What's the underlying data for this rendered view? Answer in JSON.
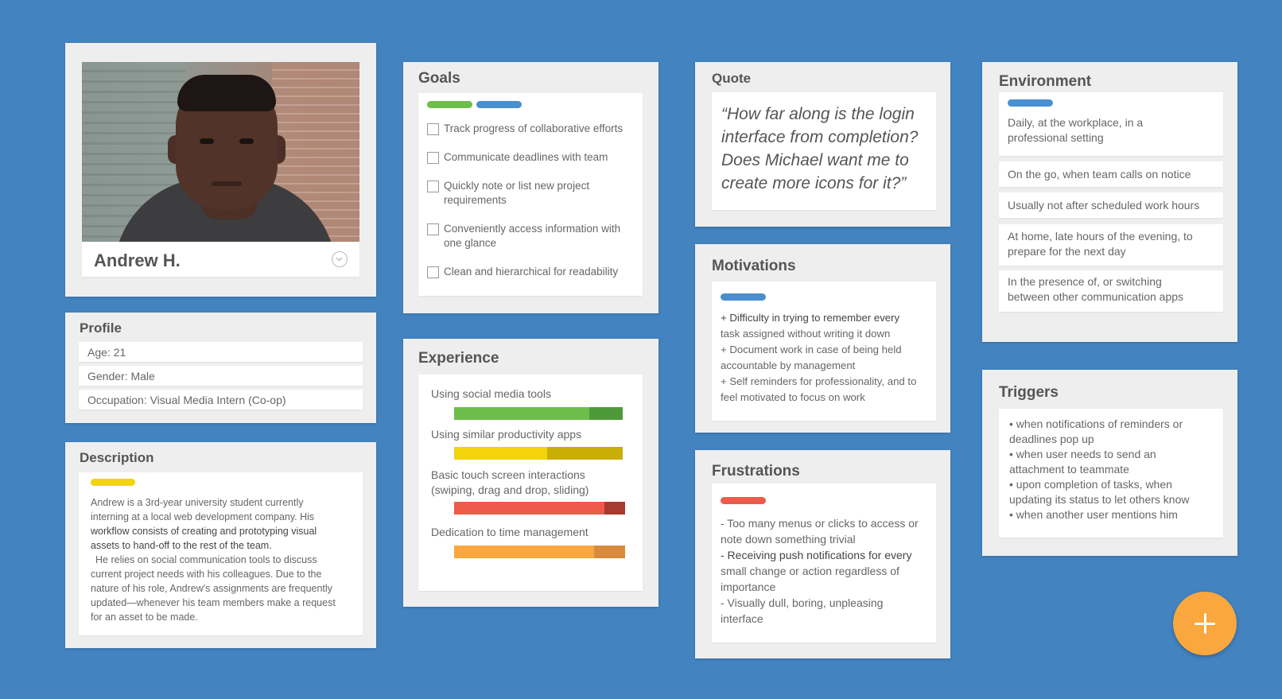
{
  "persona": {
    "name": "Andrew H.",
    "profile": {
      "title": "Profile",
      "fields": [
        "Age: 21",
        "Gender: Male",
        "Occupation: Visual Media Intern (Co-op)"
      ]
    },
    "description": {
      "title": "Description",
      "bar_color": "#f2d30c",
      "paragraph1_a": "Andrew is a 3rd-year university student currently",
      "paragraph1_b": "interning at a local web development company. His",
      "paragraph1_c": "workflow consists of creating and prototyping visual",
      "paragraph1_d": "assets to hand-off to the rest of the team.",
      "paragraph2_a": "He relies on social communication tools to discuss",
      "paragraph2_b": "current project needs with his colleagues. Due to the",
      "paragraph2_c": "nature of his role, Andrew's assignments are frequently",
      "paragraph2_d": "updated—whenever his team members make a request",
      "paragraph2_e": "for an asset to be made."
    }
  },
  "goals": {
    "title": "Goals",
    "bar_colors": [
      "#6dbe4b",
      "#4a8fd0"
    ],
    "items": [
      {
        "line1": "Track progress of collaborative efforts",
        "line2": "",
        "checked": false
      },
      {
        "line1": "Communicate deadlines with team",
        "line2": "",
        "checked": false
      },
      {
        "line1": "Quickly note or list new project",
        "line2": "requirements",
        "checked": false
      },
      {
        "line1": "Conveniently access information with",
        "line2": "one glance",
        "checked": false
      },
      {
        "line1": "Clean and hierarchical for readability",
        "line2": "",
        "checked": false
      }
    ]
  },
  "experience": {
    "title": "Experience",
    "items": [
      {
        "label": "Using social media tools",
        "label2": "",
        "level": 0.8,
        "color": "#6dbe4b",
        "accent": "#4e9a3a"
      },
      {
        "label": "Using similar productivity apps",
        "label2": "",
        "level": 0.55,
        "color": "#f2d30c",
        "accent": "#c9ae05"
      },
      {
        "label": "Basic touch screen interactions",
        "label2": "(swiping, drag and drop, sliding)",
        "level": 0.88,
        "color": "#ee5b4a",
        "accent": "#a83a2f"
      },
      {
        "label": "Dedication to time management",
        "label2": "",
        "level": 0.82,
        "color": "#f9a73e",
        "accent": "#d98a3c"
      }
    ]
  },
  "quote": {
    "title": "Quote",
    "lines": [
      "“How far along is the login",
      "interface from completion?",
      "Does Michael want me to",
      "create more icons for it?”"
    ]
  },
  "motivations": {
    "title": "Motivations",
    "bar_color": "#4a8fd0",
    "lines": [
      "+ Difficulty in trying to remember every",
      "task assigned without writing it down",
      "+ Document work in case of being held",
      "accountable by management",
      "+ Self reminders for professionality, and to",
      "feel motivated to focus on work"
    ]
  },
  "frustrations": {
    "title": "Frustrations",
    "bar_color": "#ee5b4a",
    "lines": [
      "- Too many menus or clicks to access or",
      "note down something trivial",
      "- Receiving push notifications for every",
      "small change or action regardless of",
      "importance",
      "- Visually dull, boring, unpleasing",
      "interface"
    ]
  },
  "environment": {
    "title": "Environment",
    "bar_color": "#4a8fd0",
    "items": [
      {
        "line1": "Daily, at the workplace, in a",
        "line2": "professional setting"
      },
      {
        "line1": "On the go, when team calls on notice",
        "line2": ""
      },
      {
        "line1": "Usually not after scheduled work hours",
        "line2": ""
      },
      {
        "line1": "At home, late hours of the evening, to",
        "line2": "prepare for the next day"
      },
      {
        "line1": "In the presence of, or switching",
        "line2": "between other communication apps"
      }
    ]
  },
  "triggers": {
    "title": "Triggers",
    "lines": [
      "• when notifications of reminders or",
      "deadlines pop up",
      "• when user needs to send an",
      "attachment to teammate",
      "• upon completion of tasks, when",
      "updating its status to let others know",
      "• when another user mentions him"
    ]
  },
  "fab": {
    "icon": "plus-icon",
    "color": "#f9a73e"
  },
  "colors": {
    "background": "#4283c0",
    "card": "#eeeeee"
  }
}
